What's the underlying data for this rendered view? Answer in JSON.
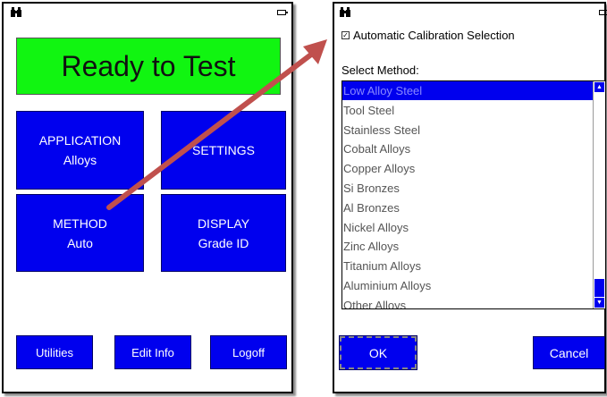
{
  "left_screen": {
    "status": {
      "left_icon": "binoculars-icon",
      "right_icon": "battery-icon"
    },
    "banner": "Ready to Test",
    "tiles": {
      "application": {
        "title": "APPLICATION",
        "value": "Alloys"
      },
      "settings": {
        "title": "SETTINGS"
      },
      "method": {
        "title": "METHOD",
        "value": "Auto"
      },
      "display": {
        "title": "DISPLAY",
        "value": "Grade ID"
      }
    },
    "buttons": {
      "utilities": "Utilities",
      "edit_info": "Edit Info",
      "logoff": "Logoff"
    }
  },
  "right_screen": {
    "status": {
      "left_icon": "binoculars-icon",
      "right_icon": "battery-icon"
    },
    "auto_calibration": {
      "label": "Automatic Calibration Selection",
      "checked": true,
      "check_mark": "✓"
    },
    "select_method_label": "Select Method:",
    "methods": [
      "Low Alloy Steel",
      "Tool Steel",
      "Stainless Steel",
      "Cobalt Alloys",
      "Copper Alloys",
      "Si Bronzes",
      "Al Bronzes",
      "Nickel Alloys",
      "Zinc Alloys",
      "Titanium Alloys",
      "Aluminium Alloys",
      "Other Alloys"
    ],
    "selected_method": "Low Alloy Steel",
    "buttons": {
      "ok": "OK",
      "cancel": "Cancel"
    }
  },
  "colors": {
    "tile_blue": "#0000ee",
    "ready_green": "#11f511",
    "arrow_red": "#c0504d",
    "selected_text": "#8888ff"
  }
}
